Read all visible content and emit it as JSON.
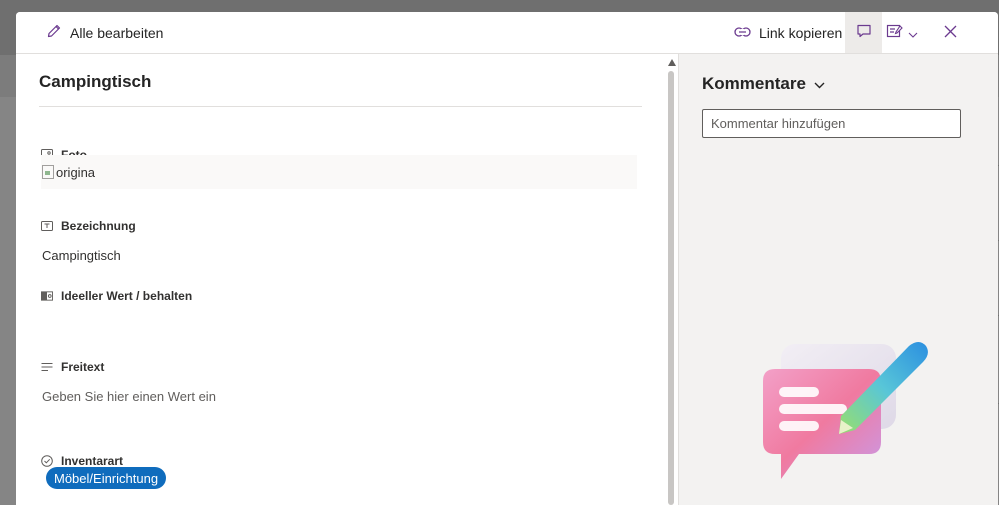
{
  "toolbar": {
    "edit_all_label": "Alle bearbeiten",
    "copy_link_label": "Link kopieren"
  },
  "item": {
    "title": "Campingtisch"
  },
  "fields": {
    "photo": {
      "label": "Foto",
      "image_alt": "origina"
    },
    "name": {
      "label": "Bezeichnung",
      "value": "Campingtisch"
    },
    "value": {
      "label": "Ideeller Wert / behalten",
      "value": ""
    },
    "freetext": {
      "label": "Freitext",
      "placeholder": "Geben Sie hier einen Wert ein"
    },
    "category": {
      "label": "Inventarart",
      "value": "Möbel/Einrichtung"
    }
  },
  "comments": {
    "title": "Kommentare",
    "input_placeholder": "Kommentar hinzufügen"
  },
  "colors": {
    "accent": "#0f6cbd",
    "panel_bg": "#ffffff",
    "comments_bg": "#f3f2f1",
    "overlay": "#8a8a8a"
  },
  "icons": {
    "edit": "pencil-icon",
    "link": "link-icon",
    "comment": "comment-icon",
    "form": "form-edit-icon",
    "close": "close-icon"
  }
}
